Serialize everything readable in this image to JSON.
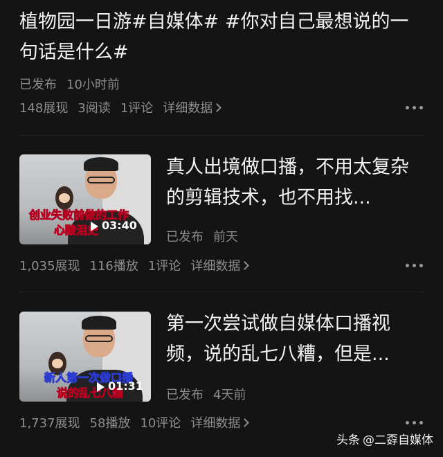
{
  "posts": [
    {
      "title": "植物园一日游#自媒体# #你对自己最想说的一句话是什么#",
      "status": "已发布",
      "time": "10小时前",
      "views": "148展现",
      "reads": "3阅读",
      "comments": "1评论",
      "detail": "详细数据"
    },
    {
      "title": "真人出境做口播，不用太复杂的剪辑技术，也不用找...",
      "status": "已发布",
      "time": "前天",
      "views": "1,035展现",
      "plays": "116播放",
      "comments": "1评论",
      "detail": "详细数据",
      "thumb_caption_1": "创业失败前做的工作",
      "thumb_caption_2": "心酸泪史",
      "duration": "03:40"
    },
    {
      "title": "第一次尝试做自媒体口播视频，说的乱七八糟，但是...",
      "status": "已发布",
      "time": "4天前",
      "views": "1,737展现",
      "plays": "58播放",
      "comments": "10评论",
      "detail": "详细数据",
      "thumb_caption_1": "新人第一次做口播",
      "thumb_caption_2": "说的乱七八糟",
      "duration": "01:31"
    }
  ],
  "watermark": {
    "brand": "头条",
    "account": "@二孬自媒体"
  },
  "icons": {
    "more": "more-dots-icon",
    "chevron": "chevron-right-icon",
    "play": "play-icon"
  }
}
